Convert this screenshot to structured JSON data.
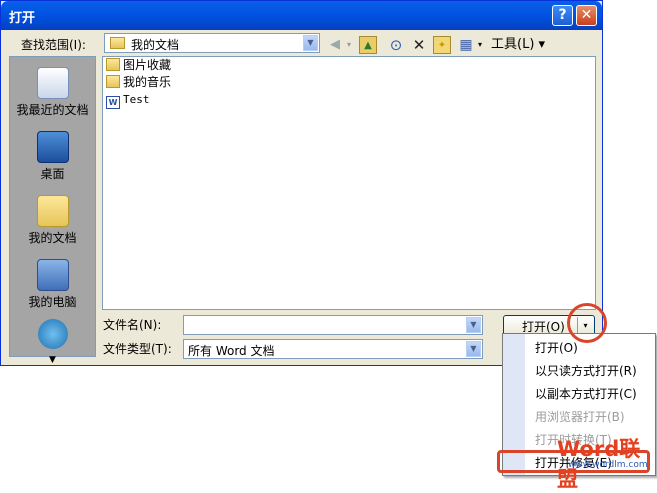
{
  "dialog": {
    "title": "打开",
    "help_label": "?",
    "close_label": "✕"
  },
  "lookin": {
    "label": "查找范围(I):",
    "value": "我的文档",
    "icon": "folder-icon"
  },
  "toolbar": {
    "tools_label": "工具(L)",
    "buttons": [
      "back-icon",
      "up-folder-icon",
      "search-web-icon",
      "delete-icon",
      "new-folder-icon",
      "views-icon"
    ]
  },
  "places": [
    {
      "label": "我最近的文档",
      "icon": "recent-documents-icon"
    },
    {
      "label": "桌面",
      "icon": "desktop-icon"
    },
    {
      "label": "我的文档",
      "icon": "my-documents-icon"
    },
    {
      "label": "我的电脑",
      "icon": "my-computer-icon"
    },
    {
      "label": "",
      "icon": "network-places-icon"
    }
  ],
  "files": [
    {
      "name": "图片收藏",
      "icon": "folder-icon"
    },
    {
      "name": "我的音乐",
      "icon": "folder-icon"
    },
    {
      "name": "Test",
      "icon": "word-document-icon"
    }
  ],
  "filename": {
    "label": "文件名(N):",
    "value": ""
  },
  "filetype": {
    "label": "文件类型(T):",
    "value": "所有 Word 文档"
  },
  "open_button": {
    "label": "打开(O)"
  },
  "open_menu": {
    "items": [
      {
        "label": "打开(O)",
        "enabled": true
      },
      {
        "label": "以只读方式打开(R)",
        "enabled": true
      },
      {
        "label": "以副本方式打开(C)",
        "enabled": true
      },
      {
        "label": "用浏览器打开(B)",
        "enabled": false
      },
      {
        "label": "打开时转换(T)",
        "enabled": false
      },
      {
        "label": "打开并修复(E)",
        "enabled": true
      }
    ]
  },
  "watermark": {
    "brand": "Word联盟",
    "url": "www.wordlm.com"
  },
  "colors": {
    "titlebar": "#0054e3",
    "dialog_bg": "#ece9d8",
    "highlight": "#d9452b"
  }
}
